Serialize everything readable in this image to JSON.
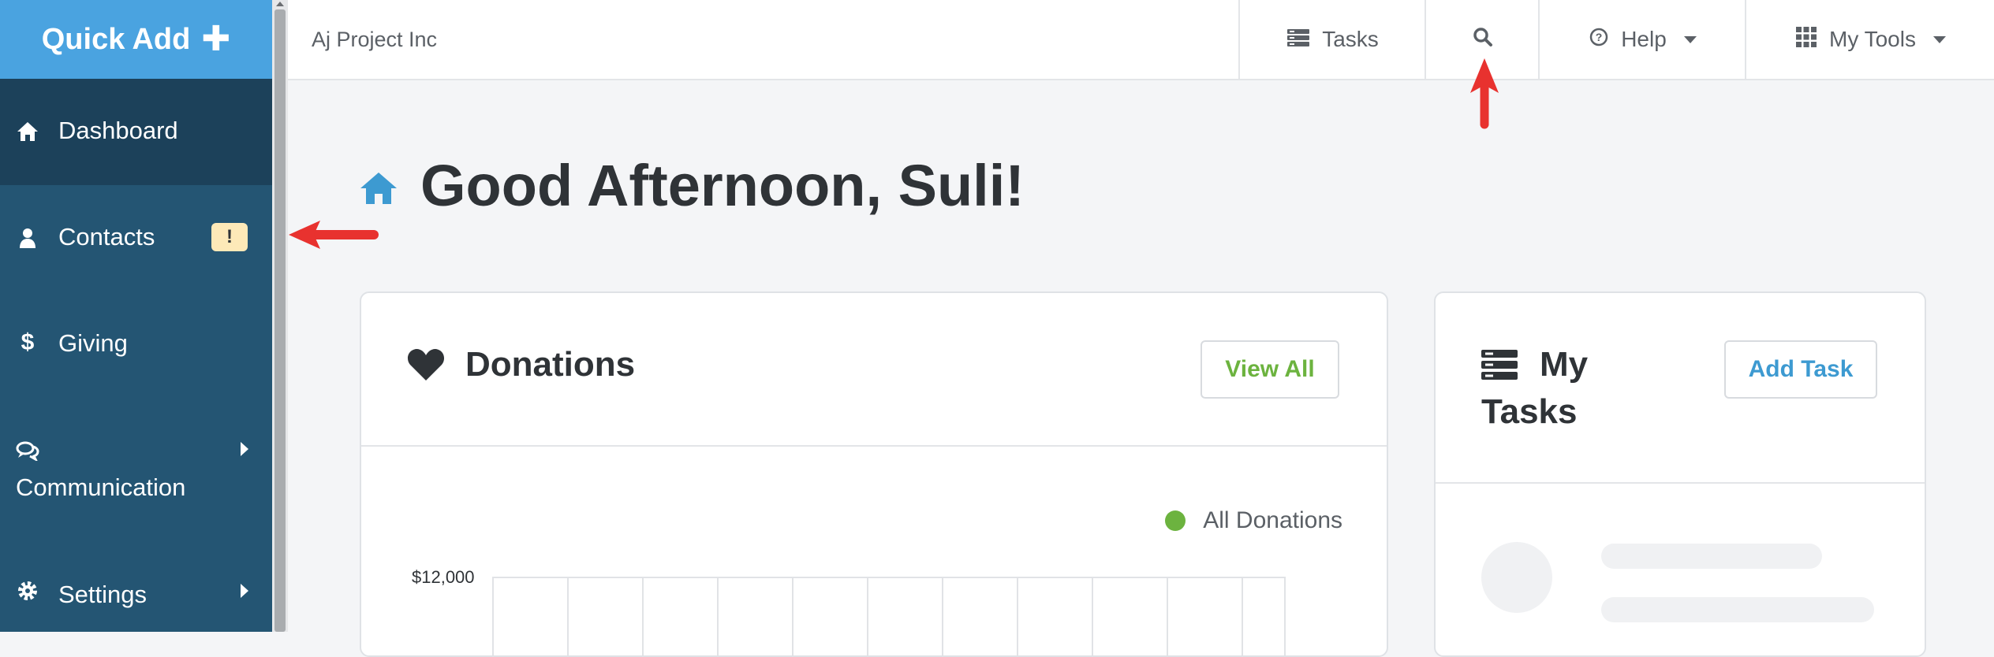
{
  "sidebar": {
    "quick_add": "Quick Add",
    "items": [
      {
        "label": "Dashboard",
        "icon": "home-icon"
      },
      {
        "label": "Contacts",
        "icon": "user-icon",
        "badge": "!"
      },
      {
        "label": "Giving",
        "icon": "dollar-icon"
      },
      {
        "label": "Communication",
        "icon": "chat-icon"
      },
      {
        "label": "Settings",
        "icon": "gear-icon"
      }
    ]
  },
  "topbar": {
    "org_name": "Aj Project Inc",
    "tasks": "Tasks",
    "help": "Help",
    "my_tools": "My Tools"
  },
  "main": {
    "greeting": "Good Afternoon, Suli!",
    "donations": {
      "title": "Donations",
      "view_all": "View All",
      "legend": "All Donations",
      "y_tick": "$12,000"
    },
    "tasks": {
      "title_line1": "My",
      "title_line2": "Tasks",
      "add_task": "Add Task"
    }
  },
  "colors": {
    "sidebar": "#245573",
    "sidebar_active": "#1c415a",
    "quick_add": "#4aa3e0",
    "accent_green": "#6cb33f",
    "accent_blue": "#3d9ad1",
    "annotation_red": "#e8322f"
  }
}
